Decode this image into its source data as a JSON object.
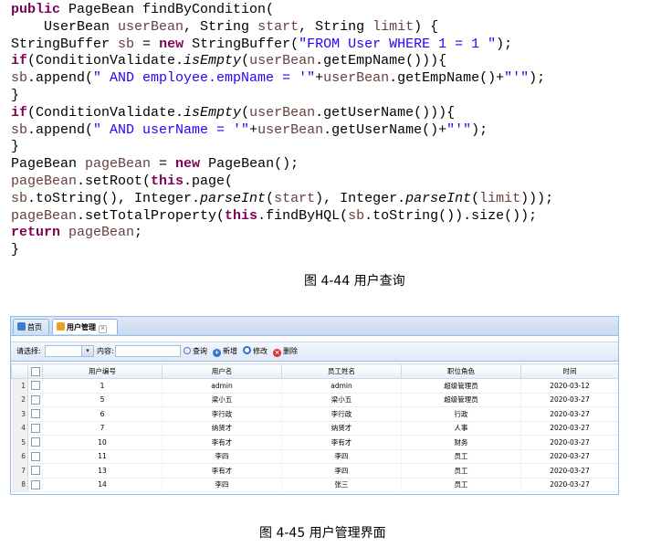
{
  "code_lines": [
    [
      {
        "t": "public",
        "c": "kw"
      },
      {
        "t": " PageBean findByCondition("
      }
    ],
    [
      {
        "t": "    UserBean "
      },
      {
        "t": "userBean",
        "c": "var"
      },
      {
        "t": ", String "
      },
      {
        "t": "start",
        "c": "var"
      },
      {
        "t": ", String "
      },
      {
        "t": "limit",
        "c": "var"
      },
      {
        "t": ") {"
      }
    ],
    [
      {
        "t": "StringBuffer "
      },
      {
        "t": "sb",
        "c": "var"
      },
      {
        "t": " = "
      },
      {
        "t": "new",
        "c": "kw"
      },
      {
        "t": " StringBuffer("
      },
      {
        "t": "\"FROM User WHERE 1 = 1 \"",
        "c": "str"
      },
      {
        "t": ");"
      }
    ],
    [
      {
        "t": "if",
        "c": "kw"
      },
      {
        "t": "(ConditionValidate."
      },
      {
        "t": "isEmpty",
        "c": "it"
      },
      {
        "t": "("
      },
      {
        "t": "userBean",
        "c": "var"
      },
      {
        "t": ".getEmpName())){"
      }
    ],
    [
      {
        "t": "sb",
        "c": "var"
      },
      {
        "t": ".append("
      },
      {
        "t": "\" AND employee.empName = '\"",
        "c": "str"
      },
      {
        "t": "+"
      },
      {
        "t": "userBean",
        "c": "var"
      },
      {
        "t": ".getEmpName()+"
      },
      {
        "t": "\"'\"",
        "c": "str"
      },
      {
        "t": ");"
      }
    ],
    [
      {
        "t": "}"
      }
    ],
    [
      {
        "t": "if",
        "c": "kw"
      },
      {
        "t": "(ConditionValidate."
      },
      {
        "t": "isEmpty",
        "c": "it"
      },
      {
        "t": "("
      },
      {
        "t": "userBean",
        "c": "var"
      },
      {
        "t": ".getUserName())){"
      }
    ],
    [
      {
        "t": "sb",
        "c": "var"
      },
      {
        "t": ".append("
      },
      {
        "t": "\" AND userName = '\"",
        "c": "str"
      },
      {
        "t": "+"
      },
      {
        "t": "userBean",
        "c": "var"
      },
      {
        "t": ".getUserName()+"
      },
      {
        "t": "\"'\"",
        "c": "str"
      },
      {
        "t": ");"
      }
    ],
    [
      {
        "t": "}"
      }
    ],
    [
      {
        "t": "PageBean "
      },
      {
        "t": "pageBean",
        "c": "var"
      },
      {
        "t": " = "
      },
      {
        "t": "new",
        "c": "kw"
      },
      {
        "t": " PageBean();"
      }
    ],
    [
      {
        "t": "pageBean",
        "c": "var"
      },
      {
        "t": ".setRoot("
      },
      {
        "t": "this",
        "c": "kw"
      },
      {
        "t": ".page("
      }
    ],
    [
      {
        "t": "sb",
        "c": "var"
      },
      {
        "t": ".toString(), Integer."
      },
      {
        "t": "parseInt",
        "c": "it"
      },
      {
        "t": "("
      },
      {
        "t": "start",
        "c": "var"
      },
      {
        "t": "), Integer."
      },
      {
        "t": "parseInt",
        "c": "it"
      },
      {
        "t": "("
      },
      {
        "t": "limit",
        "c": "var"
      },
      {
        "t": ")));"
      }
    ],
    [
      {
        "t": "pageBean",
        "c": "var"
      },
      {
        "t": ".setTotalProperty("
      },
      {
        "t": "this",
        "c": "kw"
      },
      {
        "t": ".findByHQL("
      },
      {
        "t": "sb",
        "c": "var"
      },
      {
        "t": ".toString()).size());"
      }
    ],
    [
      {
        "t": "return",
        "c": "kw"
      },
      {
        "t": " "
      },
      {
        "t": "pageBean",
        "c": "var"
      },
      {
        "t": ";"
      }
    ],
    [
      {
        "t": "}"
      }
    ]
  ],
  "caption1": "图 4-44 用户查询",
  "caption2": "图 4-45 用户管理界面",
  "ui": {
    "tabs": [
      {
        "label": "首页",
        "icon": "home-icon",
        "active": false,
        "color": "#3d7cc9"
      },
      {
        "label": "用户管理",
        "icon": "user-manage-icon",
        "active": true,
        "color": "#f0a020",
        "close": "×"
      }
    ],
    "toolbar": {
      "select_label": "请选择:",
      "select_value": "",
      "select_arrow": "▾",
      "content_label": "内容:",
      "content_value": "",
      "search_label": "查询",
      "add_label": "新增",
      "edit_label": "修改",
      "delete_label": "删除",
      "search_color": "#4a7fbf",
      "add_color": "#2f6fd0",
      "edit_color": "#2f6fd0",
      "delete_color": "#e03030"
    },
    "columns": [
      "用户编号",
      "用户名",
      "员工姓名",
      "职位角色",
      "时间"
    ],
    "rows": [
      [
        "1",
        "1",
        "admin",
        "admin",
        "超级管理员",
        "2020-03-12"
      ],
      [
        "2",
        "5",
        "梁小五",
        "梁小五",
        "超级管理员",
        "2020-03-27"
      ],
      [
        "3",
        "6",
        "李行政",
        "李行政",
        "行政",
        "2020-03-27"
      ],
      [
        "4",
        "7",
        "纳贤才",
        "纳贤才",
        "人事",
        "2020-03-27"
      ],
      [
        "5",
        "10",
        "李有才",
        "李有才",
        "财务",
        "2020-03-27"
      ],
      [
        "6",
        "11",
        "李四",
        "李四",
        "员工",
        "2020-03-27"
      ],
      [
        "7",
        "13",
        "李有才",
        "李四",
        "员工",
        "2020-03-27"
      ],
      [
        "8",
        "14",
        "李四",
        "张三",
        "员工",
        "2020-03-27"
      ]
    ]
  }
}
